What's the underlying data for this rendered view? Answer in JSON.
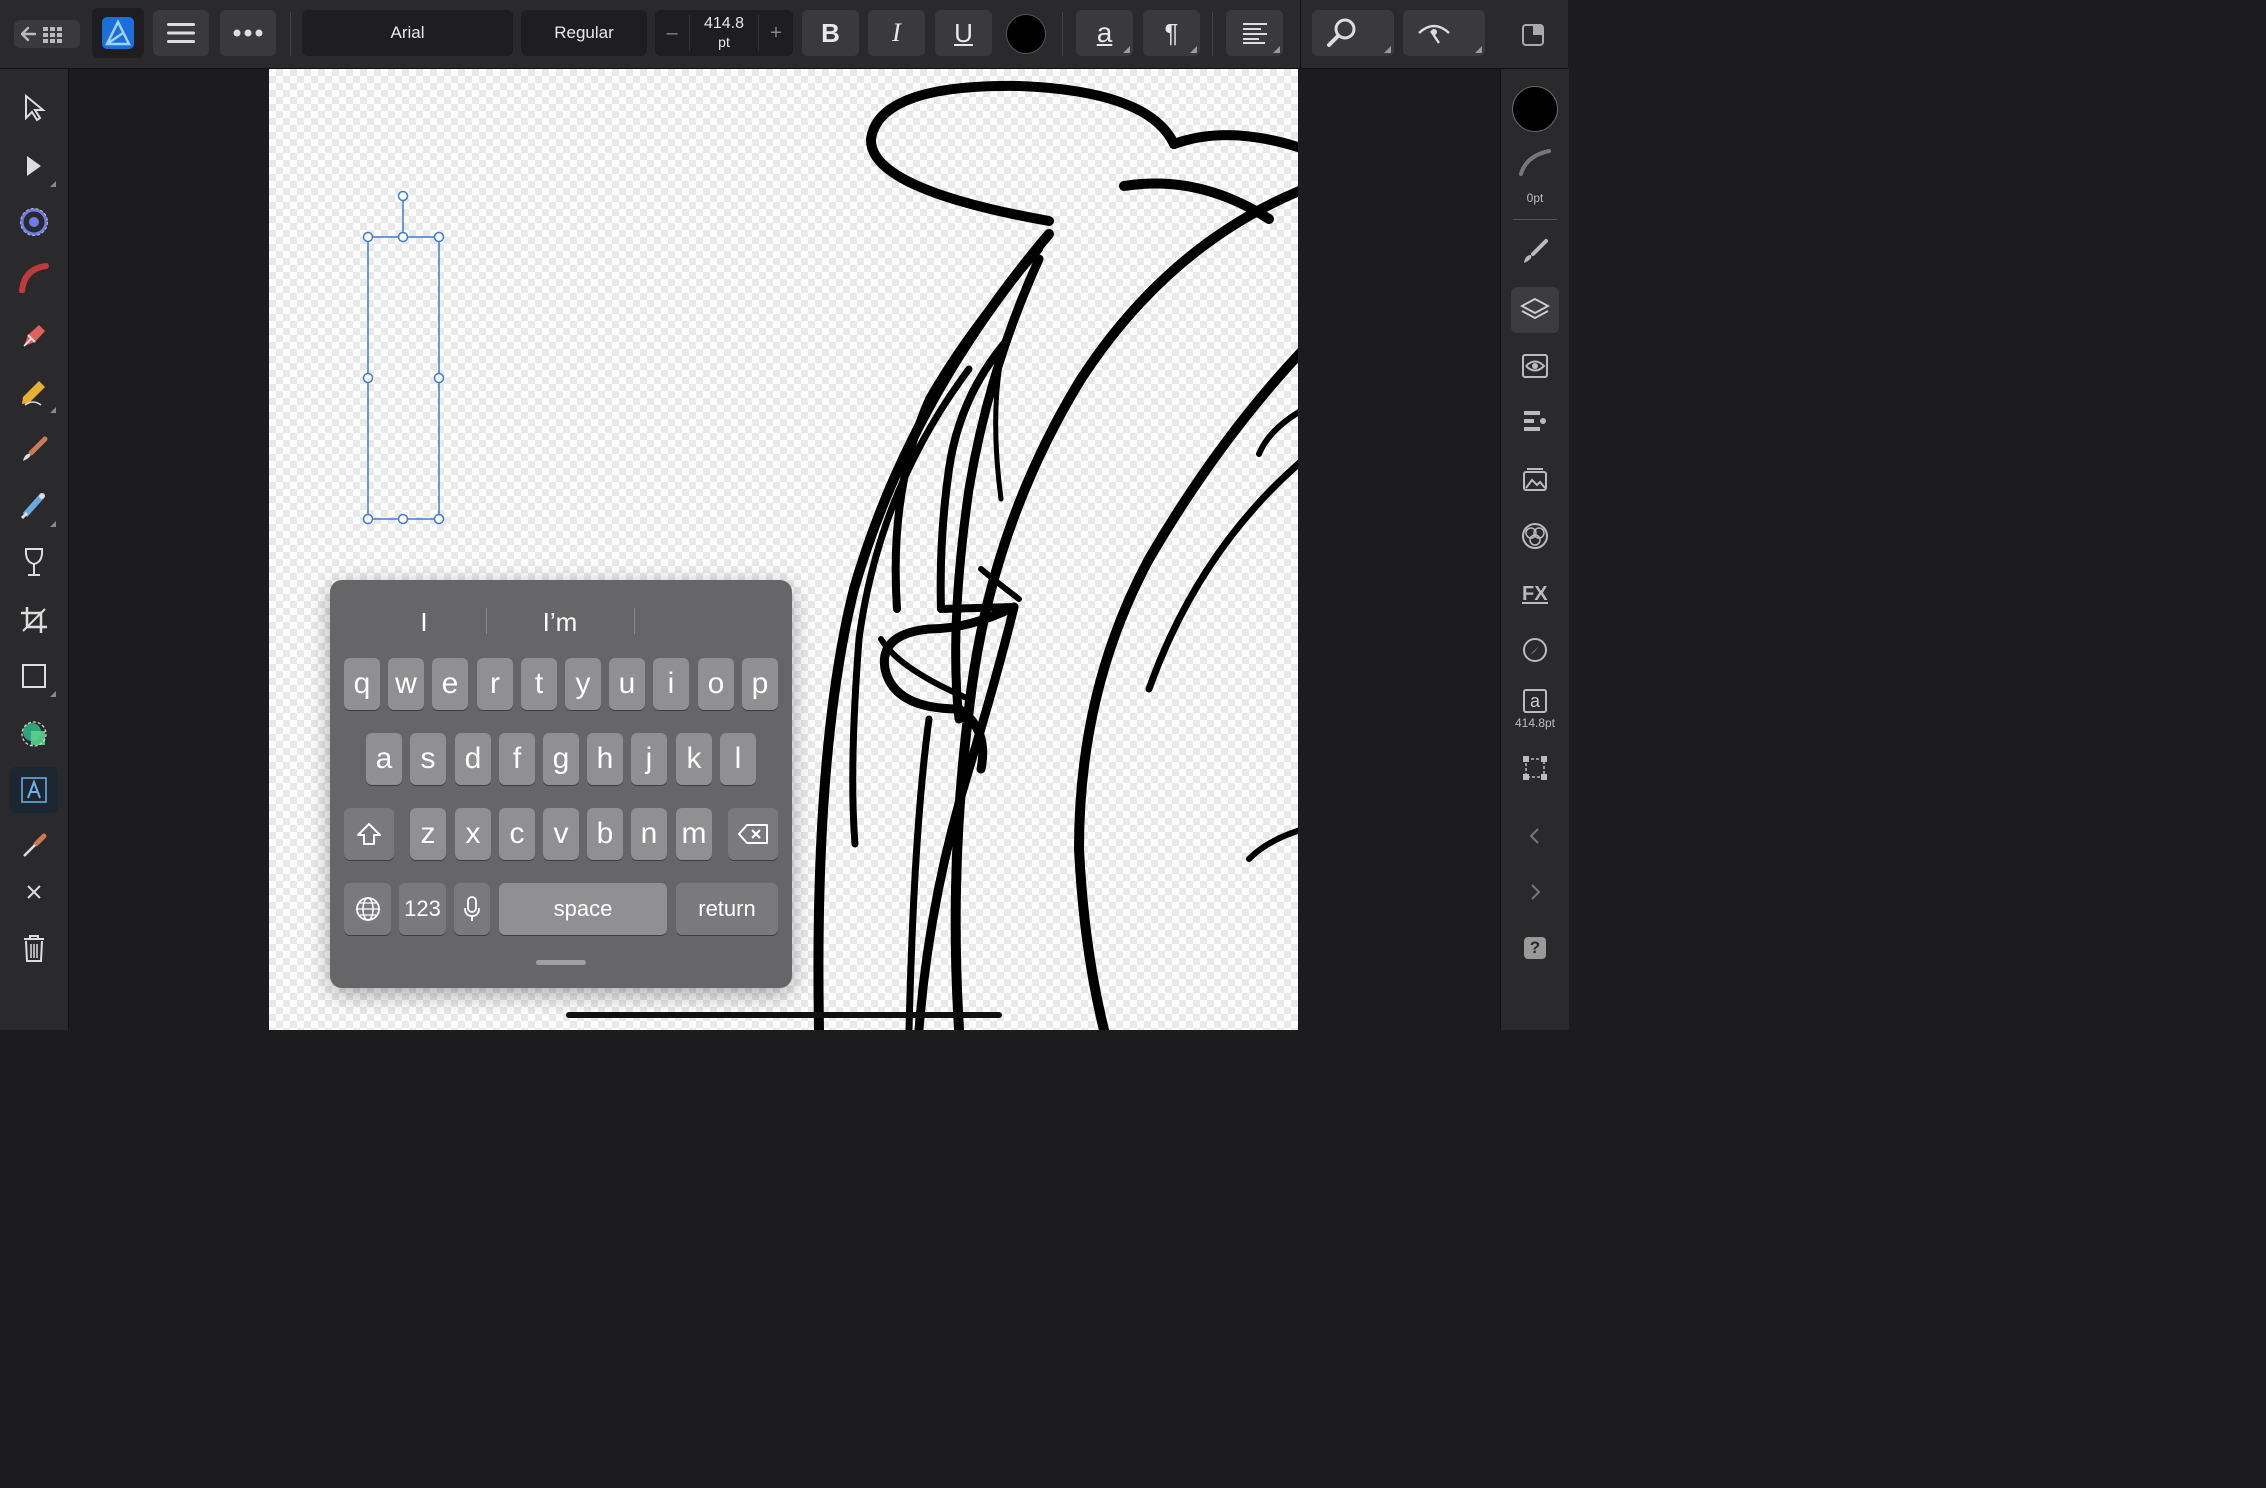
{
  "toolbar": {
    "font_family": "Arial",
    "font_style": "Regular",
    "size_decrease": "–",
    "font_size_value": "414.8",
    "font_size_unit": "pt",
    "size_increase": "+",
    "bold": "B",
    "italic": "I",
    "underline": "U",
    "text_color": "#000000",
    "char_panel": "a",
    "para_panel": "¶"
  },
  "right_panel": {
    "fill_color": "#000000",
    "stroke_width": "0pt",
    "text_size": "414.8pt",
    "text_glyph": "a",
    "help_glyph": "?"
  },
  "keyboard": {
    "suggestions": [
      "I",
      "I’m"
    ],
    "row1": [
      "q",
      "w",
      "e",
      "r",
      "t",
      "y",
      "u",
      "i",
      "o",
      "p"
    ],
    "row2": [
      "a",
      "s",
      "d",
      "f",
      "g",
      "h",
      "j",
      "k",
      "l"
    ],
    "row3": [
      "z",
      "x",
      "c",
      "v",
      "b",
      "n",
      "m"
    ],
    "numbers_label": "123",
    "space_label": "space",
    "return_label": "return"
  },
  "colors": {
    "accent": "#4a90d9",
    "selection": "#3d7bd9"
  }
}
